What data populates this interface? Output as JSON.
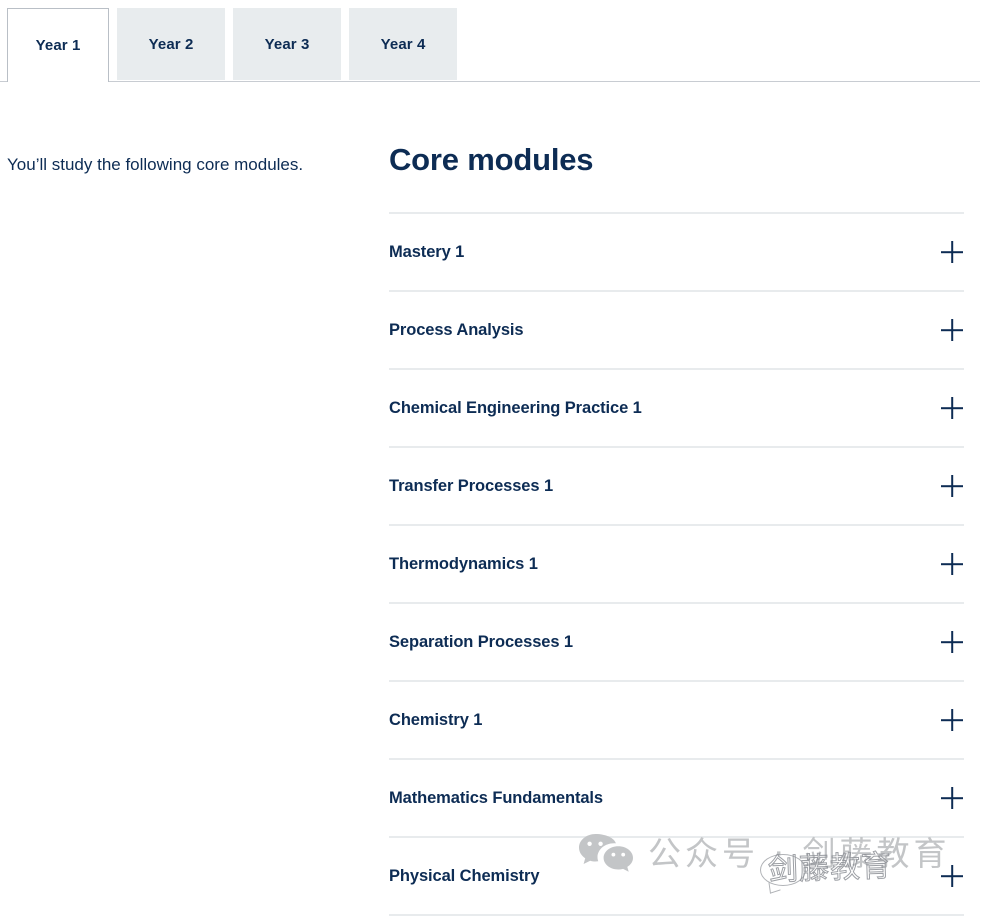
{
  "tabs": {
    "items": [
      {
        "label": "Year 1",
        "active": true
      },
      {
        "label": "Year 2",
        "active": false
      },
      {
        "label": "Year 3",
        "active": false
      },
      {
        "label": "Year 4",
        "active": false
      }
    ]
  },
  "left": {
    "intro": "You’ll study the following core modules."
  },
  "main": {
    "section_title": "Core modules",
    "toggle_icon": "plus-icon",
    "modules": [
      {
        "label": "Mastery 1"
      },
      {
        "label": "Process Analysis"
      },
      {
        "label": "Chemical Engineering Practice 1"
      },
      {
        "label": "Transfer Processes 1"
      },
      {
        "label": "Thermodynamics 1"
      },
      {
        "label": "Separation Processes 1"
      },
      {
        "label": "Chemistry 1"
      },
      {
        "label": "Mathematics Fundamentals"
      },
      {
        "label": "Physical Chemistry"
      }
    ]
  },
  "watermark": {
    "logo_icon": "wechat-icon",
    "text": "公众号 · 剑藤教育",
    "overlay_text": "剑藤教育"
  },
  "colors": {
    "navy": "#0d2c54",
    "tab_inactive_bg": "#e8ecee",
    "divider": "#e8ebed",
    "tab_border": "#b9bfc6",
    "watermark_gray": "#c3c5c7"
  }
}
